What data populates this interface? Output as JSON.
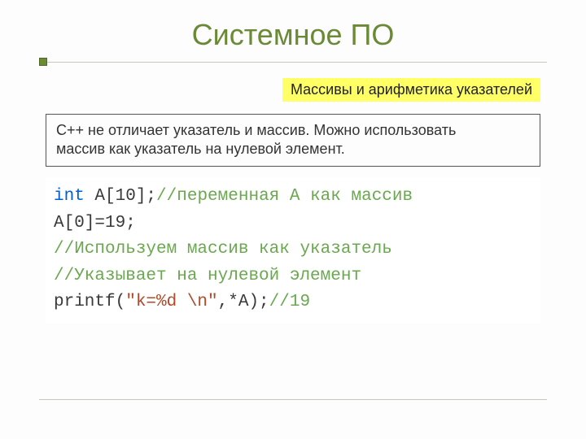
{
  "title": "Системное ПО",
  "subtitle": "Массивы и арифметика указателей",
  "body": {
    "line1": "С++  не отличает указатель и массив. Можно использовать",
    "line2": "массив как указатель на нулевой элемент."
  },
  "code": {
    "l1": {
      "kw": "int",
      "rest": "A[10];",
      "cmnt": "//переменная A как массив"
    },
    "l2": "A[0]=19;",
    "l3": "//Используем массив как указатель",
    "l4": "//Указывает на нулевой элемент",
    "l5": {
      "a": "printf(",
      "str": "\"k=%d \\n\"",
      "b": ",*A);",
      "cmnt": "//19"
    }
  }
}
